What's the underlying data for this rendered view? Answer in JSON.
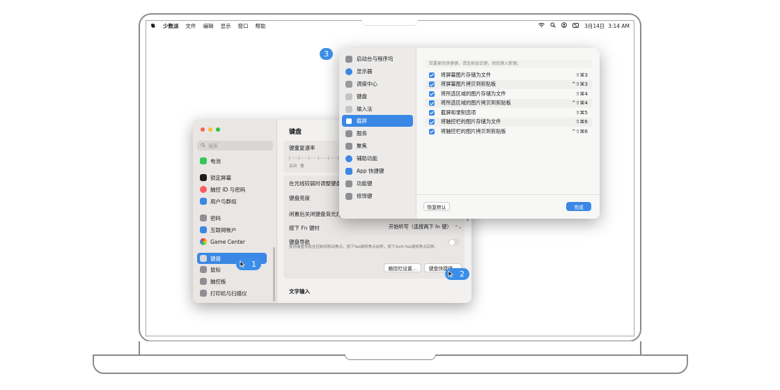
{
  "menubar": {
    "app_name": "少数派",
    "items": [
      "文件",
      "编辑",
      "显示",
      "窗口",
      "帮助"
    ],
    "datetime": "3月14日  3:14 AM"
  },
  "settings": {
    "search_placeholder": "搜索",
    "sidebar": [
      {
        "label": "电池",
        "color": "#34c759"
      },
      {
        "label": "锁定屏幕",
        "color": "#1d1d1f"
      },
      {
        "label": "触控 ID 与密码",
        "color": "#ff5a5f"
      },
      {
        "label": "用户与群组",
        "color": "#3b87e5"
      },
      {
        "label": "密码",
        "color": "#8e8e93"
      },
      {
        "label": "互联网帐户",
        "color": "#3b87e5"
      },
      {
        "label": "Game Center",
        "color": "#e0e0e0"
      },
      {
        "label": "键盘",
        "color": "#a0a0a0"
      },
      {
        "label": "鼠标",
        "color": "#8e8e93"
      },
      {
        "label": "触控板",
        "color": "#8e8e93"
      },
      {
        "label": "打印机与扫描仪",
        "color": "#8e8e93"
      }
    ],
    "title": "键盘",
    "key_repeat": "键重复速率",
    "slider_left": "关闭",
    "slider_left2": "慢",
    "low_light": "在光线较弱时调整键盘",
    "brightness": "键盘亮度",
    "idle_off": "闲置后关闭键盘背光灯",
    "fn_label": "按下 Fn 键时",
    "fn_value": "开始听写（连按两下 fn 键）",
    "nav_title": "键盘导航",
    "nav_desc": "使用键盘导航在控制间移动焦点。按下Tab键将焦点前移，按下Shift-Tab键将焦点后移。",
    "touchbar_btn": "触控栏设置...",
    "shortcuts_btn": "键盘快捷键...",
    "text_input": "文字输入"
  },
  "shortcuts": {
    "categories": [
      {
        "label": "启动台与程序坞",
        "color": "#8e8e93"
      },
      {
        "label": "显示器",
        "color": "#3b87e5"
      },
      {
        "label": "调度中心",
        "color": "#9b9b9b"
      },
      {
        "label": "键盘",
        "color": "#a0a0a0"
      },
      {
        "label": "输入法",
        "color": "#a0a0a0"
      },
      {
        "label": "截屏",
        "color": "#ffffff"
      },
      {
        "label": "服务",
        "color": "#8e8e93"
      },
      {
        "label": "聚焦",
        "color": "#8e8e93"
      },
      {
        "label": "辅助功能",
        "color": "#3b87e5"
      },
      {
        "label": "App 快捷键",
        "color": "#3b87e5"
      },
      {
        "label": "功能键",
        "color": "#8e8e93"
      },
      {
        "label": "修饰键",
        "color": "#8e8e93"
      }
    ],
    "selected_index": 5,
    "hint": "若要更改快捷键，请连按组合键，然后键入新键。",
    "items": [
      {
        "label": "将屏幕图片存储为文件",
        "key": "⇧⌘3"
      },
      {
        "label": "将屏幕图片拷贝到剪贴板",
        "key": "^⇧⌘3"
      },
      {
        "label": "将所选区域的图片存储为文件",
        "key": "⇧⌘4"
      },
      {
        "label": "将所选区域的图片拷贝到剪贴板",
        "key": "^⇧⌘4"
      },
      {
        "label": "截屏和录制选项",
        "key": "⇧⌘5"
      },
      {
        "label": "将触控栏的图片存储为文件",
        "key": "⇧⌘6"
      },
      {
        "label": "将触控栏的图片拷贝到剪贴板",
        "key": "^⇧⌘6"
      }
    ],
    "restore_btn": "恢复默认",
    "done_btn": "完成"
  },
  "badges": {
    "one": "1",
    "two": "2",
    "three": "3"
  },
  "accent": "#3b87e5"
}
